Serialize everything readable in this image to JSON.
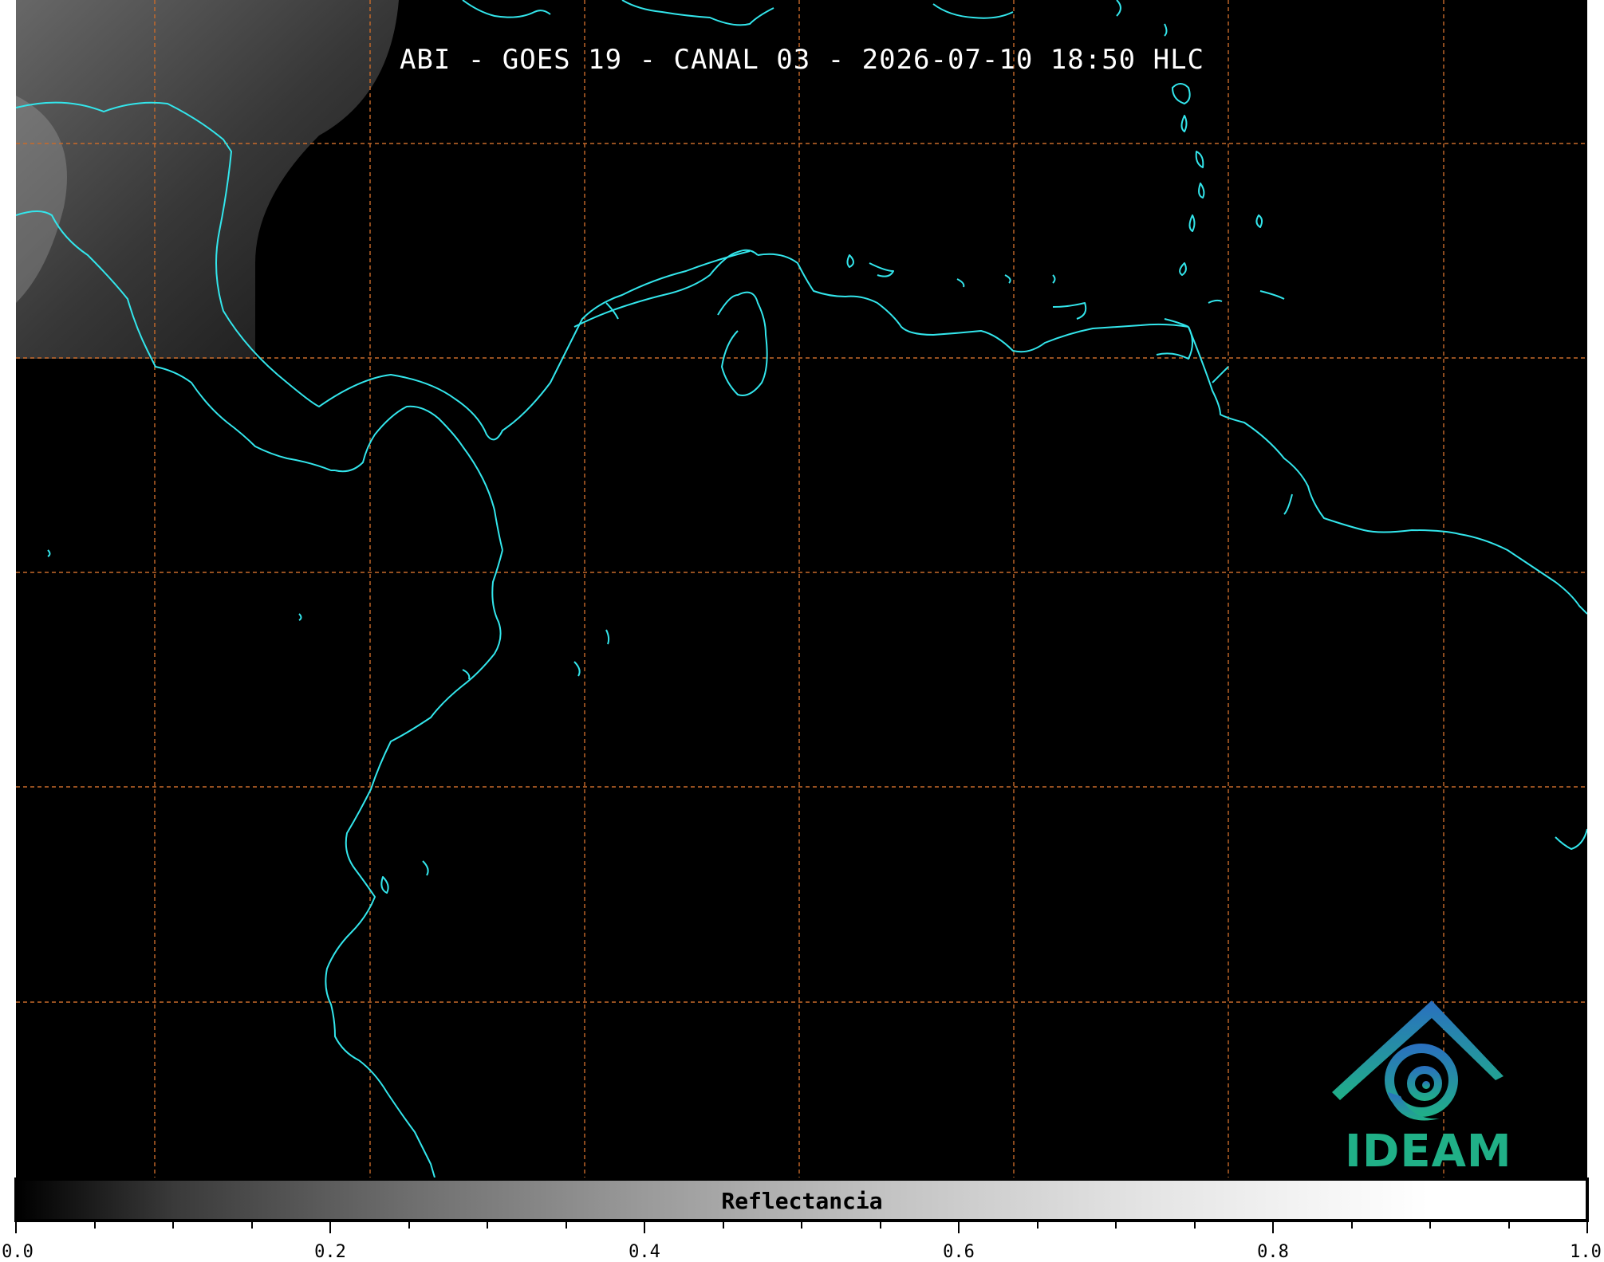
{
  "title": "ABI - GOES 19 - CANAL 03 - 2026-07-10 18:50 HLC",
  "colorbar": {
    "label": "Reflectancia",
    "tick_labels": [
      "0.0",
      "0.2",
      "0.4",
      "0.6",
      "0.8",
      "1.0"
    ],
    "range": [
      0.0,
      1.0
    ]
  },
  "logo": {
    "text": "IDEAM"
  },
  "colors": {
    "coastline": "#33e6ec",
    "gridline": "#c86a2a",
    "background": "#000000"
  },
  "map": {
    "type": "satellite-reflectance",
    "grid": true
  }
}
